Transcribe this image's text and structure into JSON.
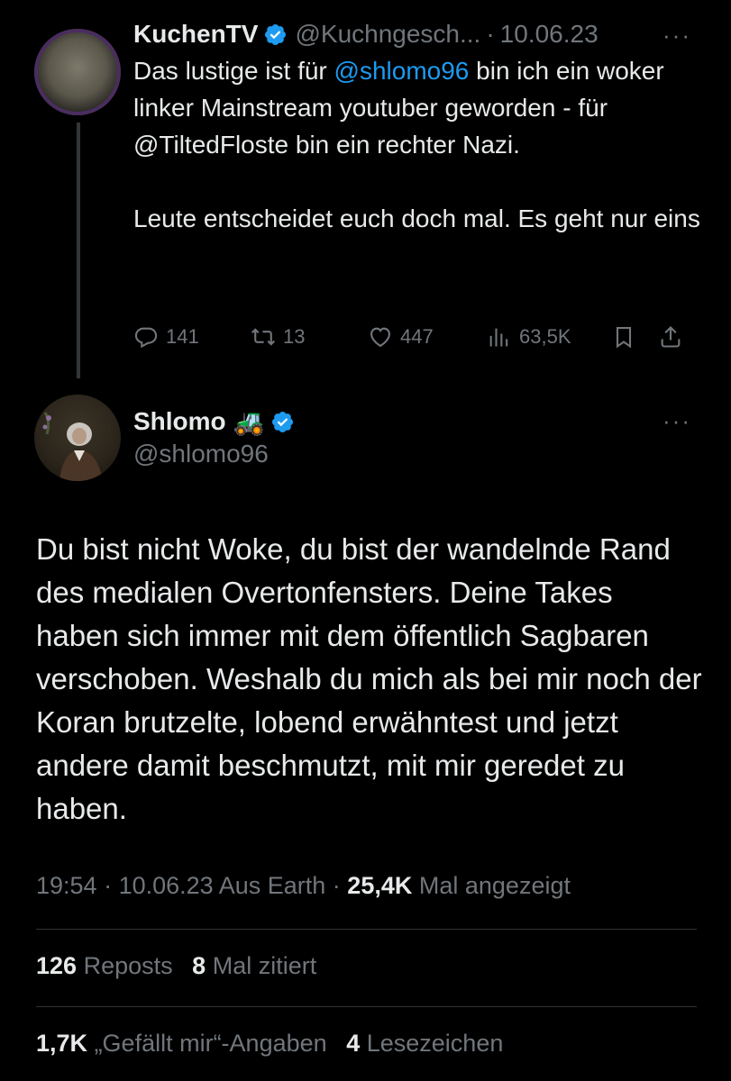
{
  "tweet1": {
    "display_name": "KuchenTV",
    "handle": "@Kuchngesch...",
    "separator": "·",
    "date": "10.06.23",
    "more": "···",
    "text_part1": "Das lustige ist für ",
    "mention": "@shlomo96",
    "text_part2": " bin ich ein woker linker Mainstream youtuber geworden - für @TiltedFloste bin ein rechter Nazi.\n\nLeute entscheidet euch doch mal. Es geht nur eins",
    "replies": "141",
    "reposts": "13",
    "likes": "447",
    "views": "63,5K"
  },
  "tweet2": {
    "display_name": "Shlomo",
    "name_emoji": "🚜",
    "handle": "@shlomo96",
    "more": "···",
    "body": "Du bist nicht Woke, du bist der wandelnde Rand des medialen Overtonfensters. Deine Takes haben sich immer mit dem öffentlich Sagbaren verschoben. Weshalb du mich als bei mir noch der Koran brutzelte, lobend erwähntest und jetzt andere damit beschmutzt, mit mir geredet zu haben.",
    "time": "19:54",
    "date": "10.06.23",
    "location": "Aus Earth",
    "views": "25,4K",
    "views_label": "Mal angezeigt",
    "reposts_count": "126",
    "reposts_label": "Reposts",
    "quotes_count": "8",
    "quotes_label": "Mal zitiert",
    "likes_count": "1,7K",
    "likes_label": "„Gefällt mir“-Angaben",
    "bookmarks_count": "4",
    "bookmarks_label": "Lesezeichen"
  },
  "colors": {
    "background": "#000000",
    "text": "#e7e9ea",
    "muted": "#71767b",
    "link": "#1d9bf0",
    "verified": "#1d9bf0"
  }
}
